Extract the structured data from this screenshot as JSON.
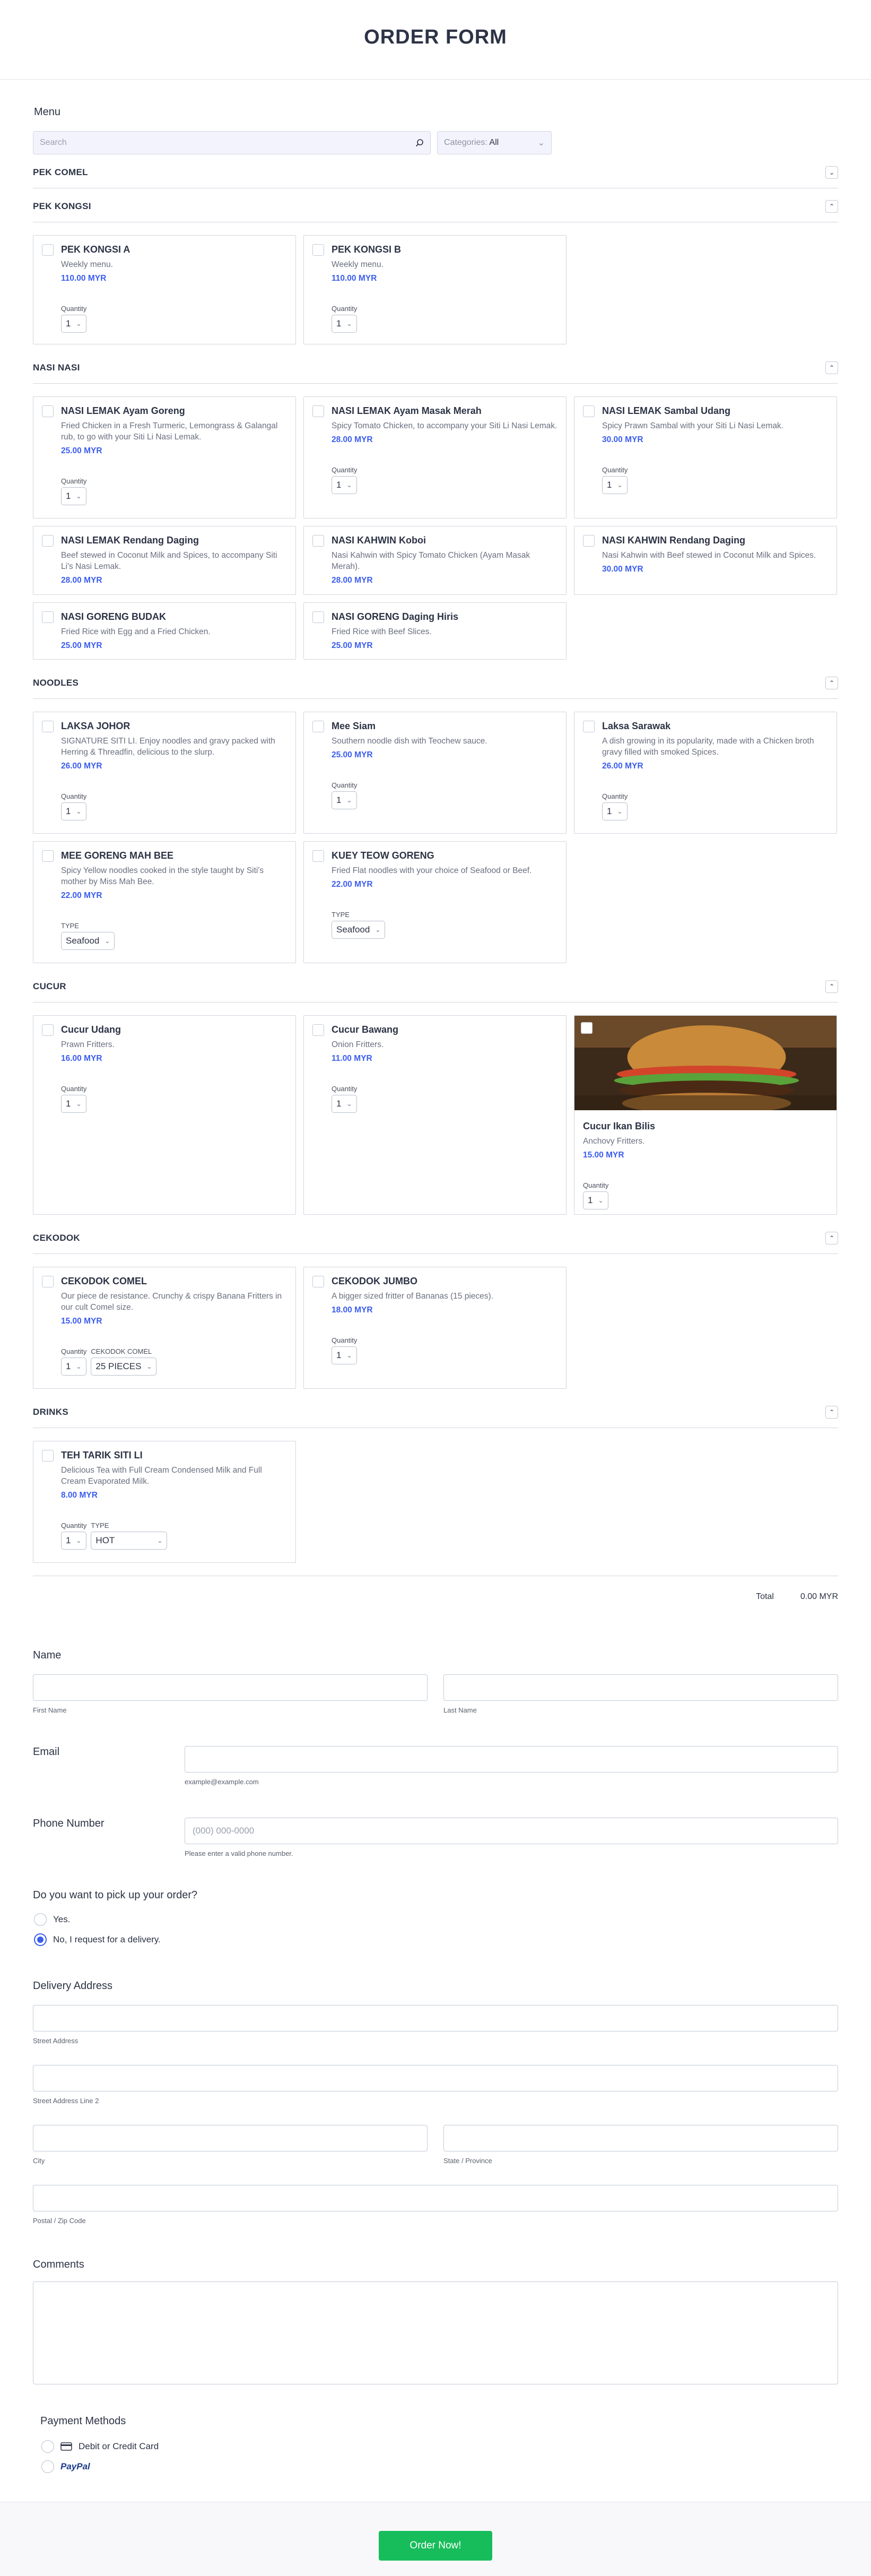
{
  "title": "ORDER FORM",
  "menu": {
    "label": "Menu",
    "search_placeholder": "Search",
    "categories_label": "Categories:",
    "categories_value": "All"
  },
  "sections": {
    "pek_comel": "PEK COMEL",
    "pek_kongsi": "PEK KONGSI",
    "nasi_nasi": "NASI NASI",
    "noodles": "NOODLES",
    "cucur": "CUCUR",
    "cekodok": "CEKODOK",
    "drinks": "DRINKS"
  },
  "labels": {
    "quantity": "Quantity",
    "type": "TYPE",
    "cekodok_comel": "CEKODOK COMEL",
    "qty_value": "1"
  },
  "products": {
    "pek_kongsi_a": {
      "name": "PEK KONGSI A",
      "desc": "Weekly menu.",
      "price": "110.00 MYR"
    },
    "pek_kongsi_b": {
      "name": "PEK KONGSI B",
      "desc": "Weekly menu.",
      "price": "110.00 MYR"
    },
    "nl_ayam_goreng": {
      "name": "NASI LEMAK Ayam Goreng",
      "desc": "Fried Chicken in a Fresh Turmeric, Lemongrass & Galangal rub, to go with your Siti Li Nasi Lemak.",
      "price": "25.00 MYR"
    },
    "nl_masak_merah": {
      "name": "NASI LEMAK Ayam Masak Merah",
      "desc": "Spicy Tomato Chicken, to accompany your Siti Li Nasi Lemak.",
      "price": "28.00 MYR"
    },
    "nl_sambal_udang": {
      "name": "NASI LEMAK Sambal Udang",
      "desc": "Spicy Prawn Sambal with your Siti Li Nasi Lemak.",
      "price": "30.00 MYR"
    },
    "nl_rendang": {
      "name": "NASI LEMAK Rendang Daging",
      "desc": "Beef stewed in Coconut Milk and Spices, to accompany Siti Li's Nasi Lemak.",
      "price": "28.00 MYR"
    },
    "nk_koboi": {
      "name": "NASI KAHWIN Koboi",
      "desc": "Nasi Kahwin with Spicy Tomato Chicken (Ayam Masak Merah).",
      "price": "28.00 MYR"
    },
    "nk_rendang": {
      "name": "NASI KAHWIN Rendang Daging",
      "desc": "Nasi Kahwin with Beef stewed in Coconut Milk and Spices.",
      "price": "30.00 MYR"
    },
    "ng_budak": {
      "name": "NASI GORENG BUDAK",
      "desc": "Fried Rice with Egg and a Fried Chicken.",
      "price": "25.00 MYR"
    },
    "ng_daging": {
      "name": "NASI GORENG Daging Hiris",
      "desc": "Fried Rice with Beef Slices.",
      "price": "25.00 MYR"
    },
    "laksa_johor": {
      "name": "LAKSA JOHOR",
      "desc": "SIGNATURE SITI LI. Enjoy noodles and gravy packed with Herring & Threadfin, delicious to the slurp.",
      "price": "26.00 MYR"
    },
    "mee_siam": {
      "name": "Mee Siam",
      "desc": "Southern noodle dish with Teochew sauce.",
      "price": "25.00 MYR"
    },
    "laksa_sarawak": {
      "name": "Laksa Sarawak",
      "desc": "A dish growing in its popularity, made with a Chicken broth gravy filled with smoked Spices.",
      "price": "26.00 MYR"
    },
    "mee_goreng": {
      "name": "MEE GORENG MAH BEE",
      "desc": "Spicy Yellow noodles cooked in the style taught by Siti's mother by Miss Mah Bee.",
      "price": "22.00 MYR",
      "type_value": "Seafood"
    },
    "kuey_teow": {
      "name": "KUEY TEOW GORENG",
      "desc": "Fried Flat noodles with your choice of Seafood or Beef.",
      "price": "22.00 MYR",
      "type_value": "Seafood"
    },
    "cucur_udang": {
      "name": "Cucur Udang",
      "desc": "Prawn Fritters.",
      "price": "16.00 MYR"
    },
    "cucur_bawang": {
      "name": "Cucur Bawang",
      "desc": "Onion Fritters.",
      "price": "11.00 MYR"
    },
    "cucur_ikan": {
      "name": "Cucur Ikan Bilis",
      "desc": "Anchovy Fritters.",
      "price": "15.00 MYR"
    },
    "cekodok_comel": {
      "name": "CEKODOK COMEL",
      "desc": "Our piece de resistance. Crunchy & crispy Banana Fritters in our cult Comel size.",
      "price": "15.00 MYR",
      "pieces_value": "25 PIECES"
    },
    "cekodok_jumbo": {
      "name": "CEKODOK JUMBO",
      "desc": "A bigger sized fritter of Bananas (15 pieces).",
      "price": "18.00 MYR"
    },
    "teh_tarik": {
      "name": "TEH TARIK SITI LI",
      "desc": "Delicious Tea with Full Cream Condensed Milk and Full Cream Evaporated Milk.",
      "price": "8.00 MYR",
      "type_value": "HOT"
    }
  },
  "total": {
    "label": "Total",
    "value": "0.00 MYR"
  },
  "form": {
    "name_label": "Name",
    "first_name": "First Name",
    "last_name": "Last Name",
    "email_label": "Email",
    "email_hint": "example@example.com",
    "phone_label": "Phone Number",
    "phone_placeholder": "(000) 000-0000",
    "phone_hint": "Please enter a valid phone number.",
    "pickup_question": "Do you want to pick up your order?",
    "pickup_yes": "Yes.",
    "pickup_no": "No, I request for a delivery.",
    "address_label": "Delivery Address",
    "street": "Street Address",
    "street2": "Street Address Line 2",
    "city": "City",
    "state": "State / Province",
    "postal": "Postal / Zip Code",
    "comments_label": "Comments",
    "payment_label": "Payment Methods",
    "payment_card": "Debit or Credit Card",
    "payment_paypal": "PayPal"
  },
  "submit_label": "Order Now!",
  "colors": {
    "accent": "#3a5cf0",
    "submit": "#18bd5b",
    "text": "#2c3345"
  }
}
